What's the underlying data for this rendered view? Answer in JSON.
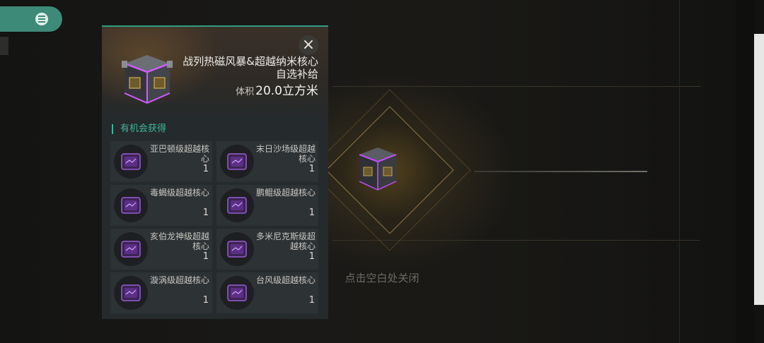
{
  "panel": {
    "title": "战列热磁风暴&超越纳米核心自选补给",
    "volume_label": "体积",
    "volume_value": "20.0立方米",
    "section_label": "有机会获得"
  },
  "items": [
    {
      "name": "亚巴顿级超越核心",
      "qty": "1"
    },
    {
      "name": "末日沙场级超越核心",
      "qty": "1"
    },
    {
      "name": "毒蝎级超越核心",
      "qty": "1"
    },
    {
      "name": "鹏鲲级超越核心",
      "qty": "1"
    },
    {
      "name": "亥伯龙神级超越核心",
      "qty": "1"
    },
    {
      "name": "多米尼克斯级超越核心",
      "qty": "1"
    },
    {
      "name": "漩涡级超越核心",
      "qty": "1"
    },
    {
      "name": "台风级超越核心",
      "qty": "1"
    }
  ],
  "hint_text": "点击空白处关闭",
  "icons": {
    "close": "close-icon",
    "menu": "menu-icon",
    "crate": "supply-crate-icon",
    "core": "core-chip-icon"
  },
  "colors": {
    "accent": "#3fb59a",
    "menu_button": "#3e8a78",
    "crate_glow": "#c94bff"
  }
}
